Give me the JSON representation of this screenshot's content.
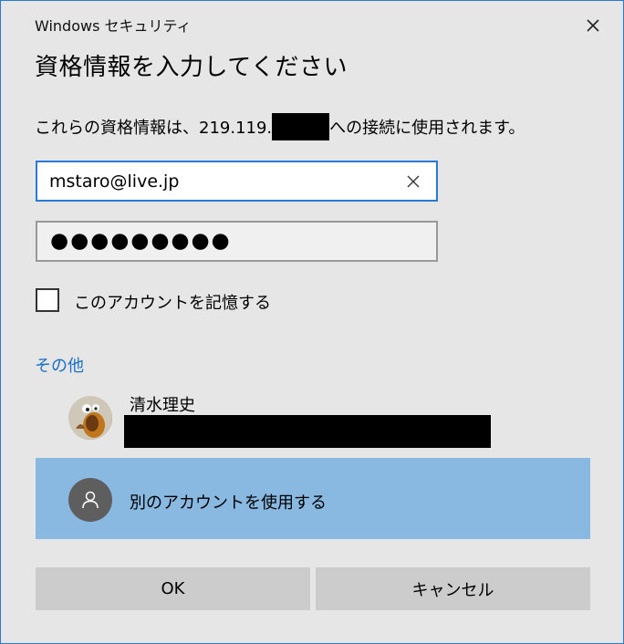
{
  "window": {
    "title": "Windows セキュリティ",
    "close_icon": "close-icon"
  },
  "heading": "資格情報を入力してください",
  "description": {
    "prefix": "これらの資格情報は、219.119.",
    "suffix": "への接続に使用されます。"
  },
  "username": {
    "value": "mstaro@live.jp"
  },
  "password": {
    "masked": "●●●●●●●●●"
  },
  "remember": {
    "label": "このアカウントを記憶する",
    "checked": false
  },
  "other_section": {
    "label": "その他"
  },
  "saved_account": {
    "name": "清水理史"
  },
  "other_account": {
    "label": "別のアカウントを使用する"
  },
  "buttons": {
    "ok": "OK",
    "cancel": "キャンセル"
  },
  "colors": {
    "accent": "#2b79d7",
    "link": "#1a6fc9",
    "selected_row": "#89b8e1",
    "button": "#cccccc"
  }
}
